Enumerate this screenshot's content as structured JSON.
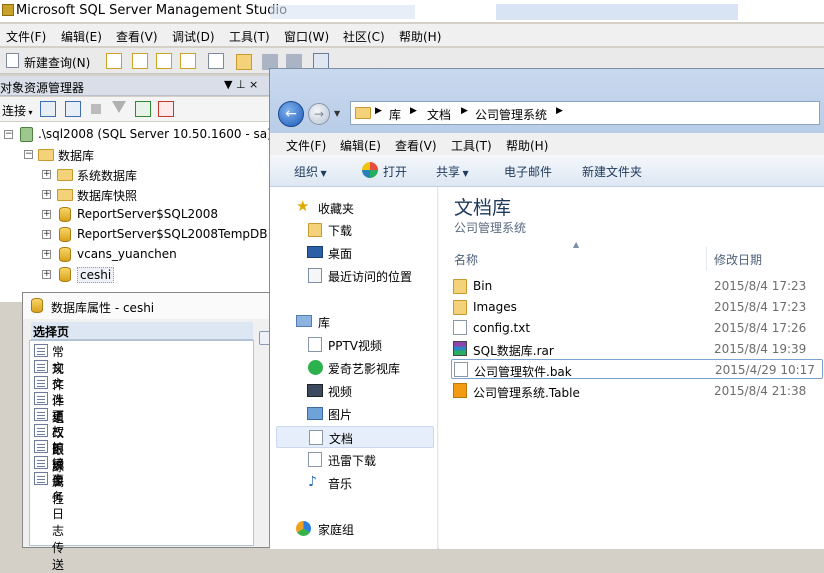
{
  "ssms": {
    "title": "Microsoft SQL Server Management Studio",
    "menu": [
      "文件(F)",
      "编辑(E)",
      "查看(V)",
      "调试(D)",
      "工具(T)",
      "窗口(W)",
      "社区(C)",
      "帮助(H)"
    ],
    "toolbar": {
      "new_query": "新建查询(N)"
    }
  },
  "object_explorer": {
    "title": "对象资源管理器",
    "pin": "▼ ⊥ ×",
    "connect": "连接",
    "root": ".\\sql2008 (SQL Server 10.50.1600 - sa)",
    "databases_folder": "数据库",
    "items": [
      {
        "label": "系统数据库",
        "kind": "folder"
      },
      {
        "label": "数据库快照",
        "kind": "folder"
      },
      {
        "label": "ReportServer$SQL2008",
        "kind": "db"
      },
      {
        "label": "ReportServer$SQL2008TempDB",
        "kind": "db"
      },
      {
        "label": "vcans_yuanchen",
        "kind": "db"
      },
      {
        "label": "ceshi",
        "kind": "db"
      }
    ]
  },
  "db_properties": {
    "title": "数据库属性 - ceshi",
    "panel_title": "选择页",
    "pages": [
      "常规",
      "文件",
      "文件组",
      "选项",
      "更改跟踪",
      "权限",
      "扩展属性",
      "镜像",
      "事务日志传送"
    ]
  },
  "explorer": {
    "breadcrumb": [
      "库",
      "文档",
      "公司管理系统"
    ],
    "menu": [
      "文件(F)",
      "编辑(E)",
      "查看(V)",
      "工具(T)",
      "帮助(H)"
    ],
    "commands": {
      "organize": "组织",
      "open": "打开",
      "share": "共享",
      "email": "电子邮件",
      "new_folder": "新建文件夹"
    },
    "nav": {
      "favorites": "收藏夹",
      "favorites_items": [
        "下载",
        "桌面",
        "最近访问的位置"
      ],
      "libraries": "库",
      "library_items": [
        "PPTV视频",
        "爱奇艺影视库",
        "视频",
        "图片",
        "文档",
        "迅雷下载",
        "音乐"
      ],
      "homegroup": "家庭组",
      "selected": "文档"
    },
    "library_title": "文档库",
    "library_subtitle": "公司管理系统",
    "columns": {
      "name": "名称",
      "modified": "修改日期"
    },
    "files": [
      {
        "name": "Bin",
        "date": "2015/8/4 17:23",
        "icon": "folder-icon"
      },
      {
        "name": "Images",
        "date": "2015/8/4 17:23",
        "icon": "folder-icon"
      },
      {
        "name": "config.txt",
        "date": "2015/8/4 17:26",
        "icon": "text-file-icon"
      },
      {
        "name": "SQL数据库.rar",
        "date": "2015/8/4 19:39",
        "icon": "rar-archive-icon"
      },
      {
        "name": "公司管理软件.bak",
        "date": "2015/4/29 10:17",
        "icon": "blank-file-icon"
      },
      {
        "name": "公司管理系统.Table",
        "date": "2015/8/4 21:38",
        "icon": "table-file-icon"
      }
    ],
    "selected_file": "公司管理软件.bak"
  }
}
